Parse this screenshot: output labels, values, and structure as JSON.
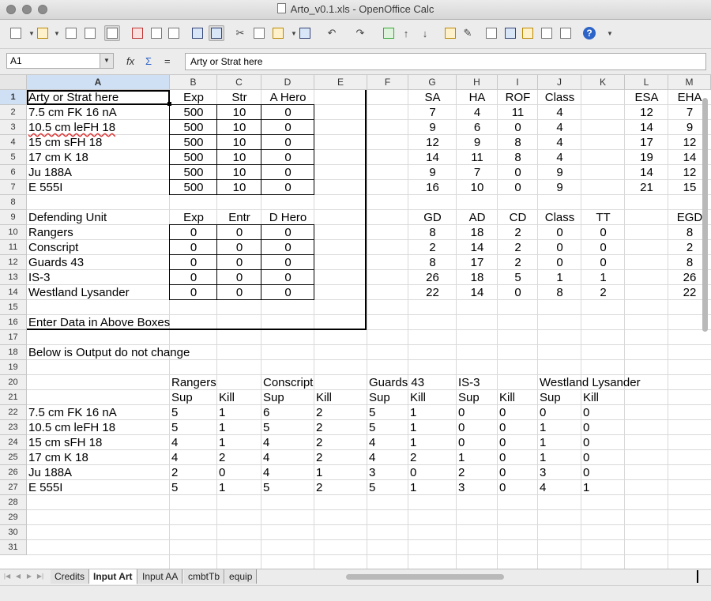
{
  "window": {
    "title": "Arto_v0.1.xls - OpenOffice Calc"
  },
  "toolbar": {
    "icons": [
      "new-icon",
      "open-icon",
      "save-icon",
      "email-icon",
      "edit-file-icon",
      "export-pdf-icon",
      "print-icon",
      "page-preview-icon",
      "spellcheck-icon",
      "autospellcheck-icon",
      "cut-icon",
      "copy-icon",
      "paste-icon",
      "format-paintbrush-icon",
      "undo-icon",
      "redo-icon",
      "hyperlink-icon",
      "sort-ascending-icon",
      "sort-descending-icon",
      "chart-icon",
      "draw-functions-icon",
      "find-icon",
      "navigator-icon",
      "gallery-icon",
      "data-sources-icon",
      "zoom-icon",
      "help-icon"
    ]
  },
  "formula_bar": {
    "cell_ref": "A1",
    "fx_label": "fx",
    "sum_label": "Σ",
    "equals_label": "=",
    "content": "Arty or Strat here"
  },
  "columns": [
    "A",
    "B",
    "C",
    "D",
    "E",
    "F",
    "G",
    "H",
    "I",
    "J",
    "K",
    "L",
    "M"
  ],
  "rows": [
    "1",
    "2",
    "3",
    "4",
    "5",
    "6",
    "7",
    "8",
    "9",
    "10",
    "11",
    "12",
    "13",
    "14",
    "15",
    "16",
    "17",
    "18",
    "19",
    "20",
    "21",
    "22",
    "23",
    "24",
    "25",
    "26",
    "27",
    "28",
    "29",
    "30",
    "31"
  ],
  "input_art": {
    "header": [
      "Arty or Strat here",
      "Exp",
      "Str",
      "A Hero"
    ],
    "rows": [
      [
        "7.5 cm FK 16 nA",
        "500",
        "10",
        "0"
      ],
      [
        "10.5 cm leFH 18",
        "500",
        "10",
        "0"
      ],
      [
        "15 cm sFH 18",
        "500",
        "10",
        "0"
      ],
      [
        "17 cm K 18",
        "500",
        "10",
        "0"
      ],
      [
        "Ju 188A",
        "500",
        "10",
        "0"
      ],
      [
        "E 555I",
        "500",
        "10",
        "0"
      ]
    ]
  },
  "defending": {
    "header": [
      "Defending Unit",
      "Exp",
      "Entr",
      "D Hero"
    ],
    "rows": [
      [
        "Rangers",
        "0",
        "0",
        "0"
      ],
      [
        "Conscript",
        "0",
        "0",
        "0"
      ],
      [
        "Guards 43",
        "0",
        "0",
        "0"
      ],
      [
        "IS-3",
        "0",
        "0",
        "0"
      ],
      [
        "Westland Lysander",
        "0",
        "0",
        "0"
      ]
    ]
  },
  "note_enter": "Enter Data in Above Boxes",
  "note_output": "Below is Output do not change",
  "art_stats": {
    "header": [
      "SA",
      "HA",
      "ROF",
      "Class",
      "",
      "ESA",
      "EHA"
    ],
    "rows": [
      [
        "7",
        "4",
        "11",
        "4",
        "",
        "12",
        "7"
      ],
      [
        "9",
        "6",
        "0",
        "4",
        "",
        "14",
        "9"
      ],
      [
        "12",
        "9",
        "8",
        "4",
        "",
        "17",
        "12"
      ],
      [
        "14",
        "11",
        "8",
        "4",
        "",
        "19",
        "14"
      ],
      [
        "9",
        "7",
        "0",
        "9",
        "",
        "14",
        "12"
      ],
      [
        "16",
        "10",
        "0",
        "9",
        "",
        "21",
        "15"
      ]
    ]
  },
  "def_stats": {
    "header": [
      "GD",
      "AD",
      "CD",
      "Class",
      "TT",
      "",
      "EGD"
    ],
    "rows": [
      [
        "8",
        "18",
        "2",
        "0",
        "0",
        "",
        "8"
      ],
      [
        "2",
        "14",
        "2",
        "0",
        "0",
        "",
        "2"
      ],
      [
        "8",
        "17",
        "2",
        "0",
        "0",
        "",
        "8"
      ],
      [
        "26",
        "18",
        "5",
        "1",
        "1",
        "",
        "26"
      ],
      [
        "22",
        "14",
        "0",
        "8",
        "2",
        "",
        "22"
      ]
    ]
  },
  "output": {
    "units": [
      "Rangers",
      "Conscript",
      "Guards 43",
      "IS-3",
      "Westland Lysander"
    ],
    "sub": [
      "Sup",
      "Kill"
    ],
    "rows": [
      [
        "7.5 cm FK 16 nA",
        "5",
        "1",
        "6",
        "2",
        "5",
        "1",
        "0",
        "0",
        "0",
        "0"
      ],
      [
        "10.5 cm leFH 18",
        "5",
        "1",
        "5",
        "2",
        "5",
        "1",
        "0",
        "0",
        "1",
        "0"
      ],
      [
        "15 cm sFH 18",
        "4",
        "1",
        "4",
        "2",
        "4",
        "1",
        "0",
        "0",
        "1",
        "0"
      ],
      [
        "17 cm K 18",
        "4",
        "2",
        "4",
        "2",
        "4",
        "2",
        "1",
        "0",
        "1",
        "0"
      ],
      [
        "Ju 188A",
        "2",
        "0",
        "4",
        "1",
        "3",
        "0",
        "2",
        "0",
        "3",
        "0"
      ],
      [
        "E 555I",
        "5",
        "1",
        "5",
        "2",
        "5",
        "1",
        "3",
        "0",
        "4",
        "1"
      ]
    ]
  },
  "tabs": [
    "Credits",
    "Input Art",
    "Input AA",
    "cmbtTb",
    "equip"
  ],
  "active_tab": "Input Art"
}
